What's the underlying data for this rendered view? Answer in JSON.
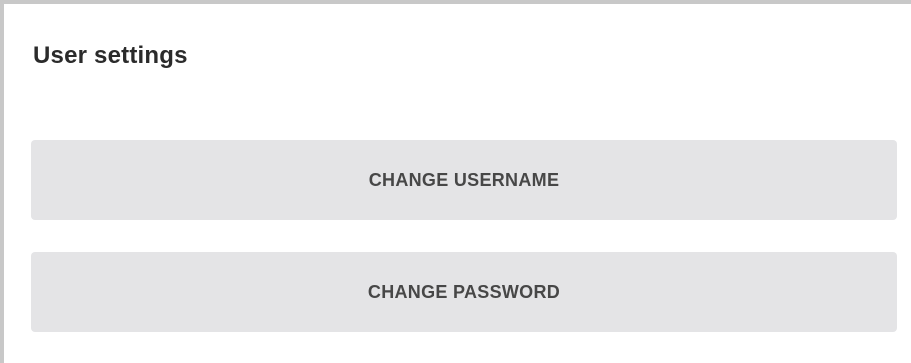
{
  "settings": {
    "title": "User settings",
    "change_username_label": "CHANGE USERNAME",
    "change_password_label": "CHANGE PASSWORD"
  },
  "colors": {
    "panel_border": "#c8c8c8",
    "button_background": "#e4e4e6",
    "button_text": "#474747",
    "title_text": "#2b2b2b"
  }
}
